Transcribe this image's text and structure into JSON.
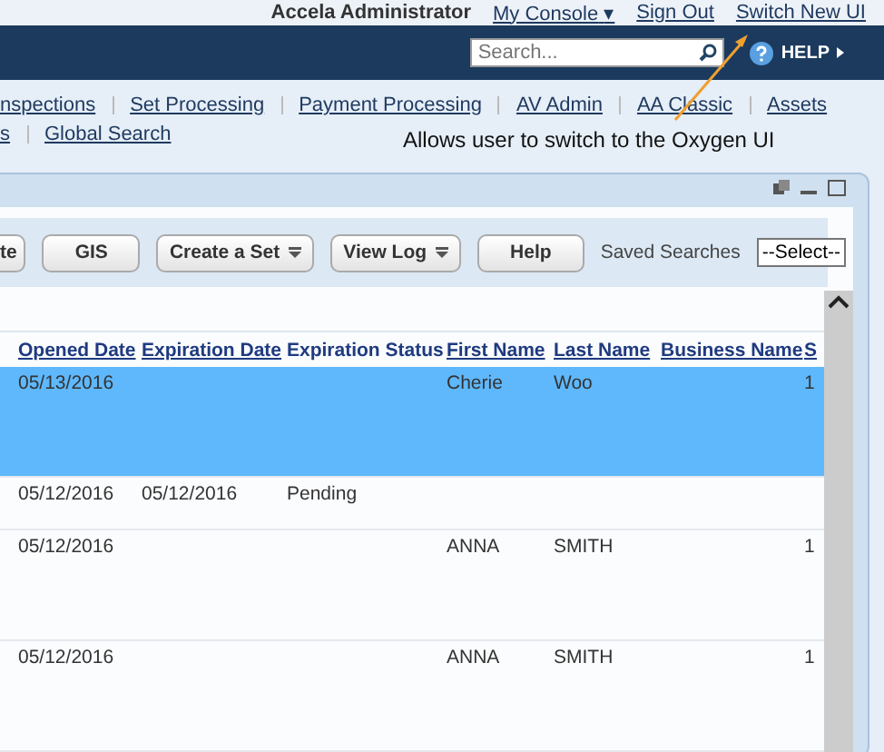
{
  "top_links": {
    "user": "Accela Administrator",
    "console": "My Console",
    "console_caret": "▾",
    "sign_out": "Sign Out",
    "switch_ui": "Switch New UI"
  },
  "search": {
    "placeholder": "Search..."
  },
  "help": "HELP",
  "nav_rows": [
    [
      "nspections",
      "Set Processing",
      "Payment Processing",
      "AV Admin",
      "AA Classic",
      "Assets"
    ],
    [
      "s",
      "Global Search"
    ]
  ],
  "annotation": "Allows user to switch to the Oxygen UI",
  "toolbar": {
    "buttons": [
      {
        "label": "te",
        "menu": false
      },
      {
        "label": "GIS",
        "menu": false
      },
      {
        "label": "Create a Set",
        "menu": true
      },
      {
        "label": "View Log",
        "menu": true
      },
      {
        "label": "Help",
        "menu": false
      }
    ],
    "saved_label": "Saved Searches",
    "saved_value": "--Select--"
  },
  "table": {
    "columns": [
      {
        "label": "Opened Date",
        "link": true
      },
      {
        "label": "Expiration Date",
        "link": true
      },
      {
        "label": "Expiration Status",
        "link": false
      },
      {
        "label": "First Name",
        "link": true
      },
      {
        "label": "Last Name",
        "link": true
      },
      {
        "label": "Business Name",
        "link": true
      },
      {
        "label": "S",
        "link": true
      }
    ],
    "rows": [
      {
        "selected": true,
        "tall": true,
        "cells": [
          "05/13/2016",
          "",
          "",
          "Cherie",
          "Woo",
          "",
          "1"
        ]
      },
      {
        "selected": false,
        "tall": false,
        "cells": [
          "05/12/2016",
          "05/12/2016",
          "Pending",
          "",
          "",
          "",
          ""
        ]
      },
      {
        "selected": false,
        "tall": true,
        "cells": [
          "05/12/2016",
          "",
          "",
          "ANNA",
          "SMITH",
          "",
          "1"
        ]
      },
      {
        "selected": false,
        "tall": true,
        "cells": [
          "05/12/2016",
          "",
          "",
          "ANNA",
          "SMITH",
          "",
          "1"
        ]
      }
    ]
  }
}
